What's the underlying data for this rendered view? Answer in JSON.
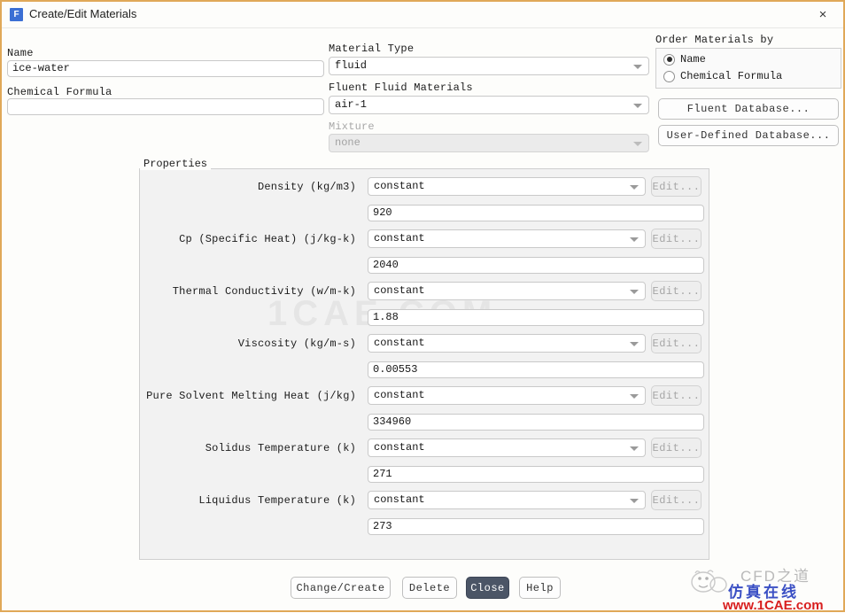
{
  "window": {
    "title": "Create/Edit Materials",
    "app_icon": "fluent-icon",
    "app_icon_glyph": "F",
    "close_icon": "×",
    "border_color": "#e0a858"
  },
  "left": {
    "name_label": "Name",
    "name_value": "ice-water",
    "formula_label": "Chemical Formula",
    "formula_value": ""
  },
  "middle": {
    "material_type_label": "Material Type",
    "material_type_value": "fluid",
    "fluent_fluid_label": "Fluent Fluid Materials",
    "fluent_fluid_value": "air-1",
    "mixture_label": "Mixture",
    "mixture_value": "none"
  },
  "order_by": {
    "title": "Order Materials by",
    "options": [
      {
        "label": "Name",
        "selected": true
      },
      {
        "label": "Chemical Formula",
        "selected": false
      }
    ],
    "fluent_database_button": "Fluent Database...",
    "user_defined_database_button": "User-Defined Database..."
  },
  "properties": {
    "title": "Properties",
    "edit_button_label": "Edit...",
    "rows": [
      {
        "label": "Density (kg/m3)",
        "method": "constant",
        "value": "920"
      },
      {
        "label": "Cp (Specific Heat) (j/kg-k)",
        "method": "constant",
        "value": "2040"
      },
      {
        "label": "Thermal Conductivity (w/m-k)",
        "method": "constant",
        "value": "1.88"
      },
      {
        "label": "Viscosity (kg/m-s)",
        "method": "constant",
        "value": "0.00553"
      },
      {
        "label": "Pure Solvent Melting Heat (j/kg)",
        "method": "constant",
        "value": "334960"
      },
      {
        "label": "Solidus Temperature (k)",
        "method": "constant",
        "value": "271"
      },
      {
        "label": "Liquidus Temperature (k)",
        "method": "constant",
        "value": "273"
      }
    ]
  },
  "footer": {
    "buttons": [
      {
        "label": "Change/Create",
        "primary": false
      },
      {
        "label": "Delete",
        "primary": false
      },
      {
        "label": "Close",
        "primary": true
      },
      {
        "label": "Help",
        "primary": false
      }
    ]
  },
  "watermark": {
    "center": "1CAE.COM",
    "brand_cn": "CFD之道",
    "sub_cn": "仿真在线",
    "url": "www.1CAE.com"
  }
}
